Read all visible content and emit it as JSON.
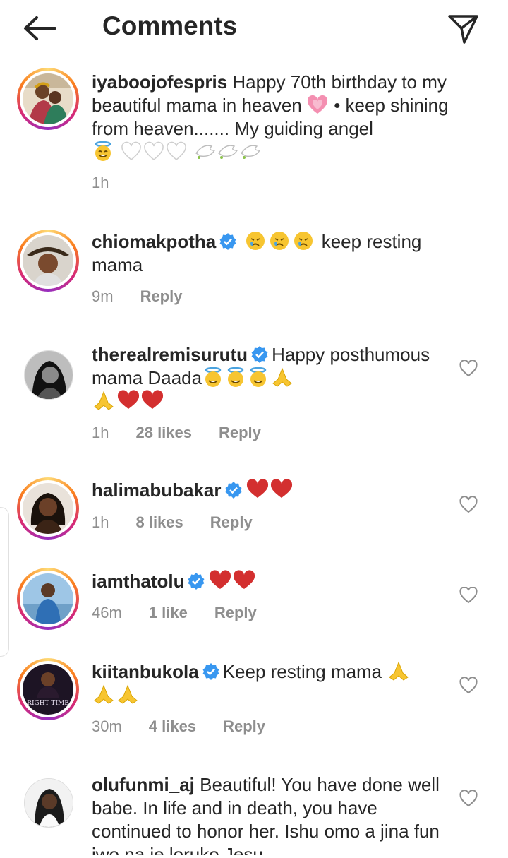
{
  "header": {
    "title": "Comments"
  },
  "caption": {
    "username": "iyaboojofespris",
    "text_1": "Happy 70th birthday to my beautiful mama in heaven",
    "text_2": " • keep shining from heaven....... My guiding angel",
    "time": "1h"
  },
  "comments": [
    {
      "username": "chiomakpotha",
      "verified": true,
      "text": "keep resting mama",
      "time": "9m",
      "likes": "",
      "reply": "Reply"
    },
    {
      "username": "therealremisurutu",
      "verified": true,
      "text": "Happy posthumous mama Daada",
      "time": "1h",
      "likes": "28 likes",
      "reply": "Reply"
    },
    {
      "username": "halimabubakar",
      "verified": true,
      "text": "",
      "time": "1h",
      "likes": "8 likes",
      "reply": "Reply"
    },
    {
      "username": "iamthatolu",
      "verified": true,
      "text": "",
      "time": "46m",
      "likes": "1 like",
      "reply": "Reply"
    },
    {
      "username": "kiitanbukola",
      "verified": true,
      "text": "Keep resting mama",
      "time": "30m",
      "likes": "4 likes",
      "reply": "Reply",
      "avatar_text": "RIGHT TIME"
    },
    {
      "username": "olufunmi_aj",
      "verified": false,
      "text": "Beautiful! You have done well babe. In life and in death, you have continued to honor her. Ishu omo a jina fun iwo na je loruko Jesu",
      "time": "",
      "likes": "",
      "reply": ""
    }
  ],
  "colors": {
    "verified": "#3897f0",
    "meta": "#8e8e8e",
    "text": "#262626"
  }
}
